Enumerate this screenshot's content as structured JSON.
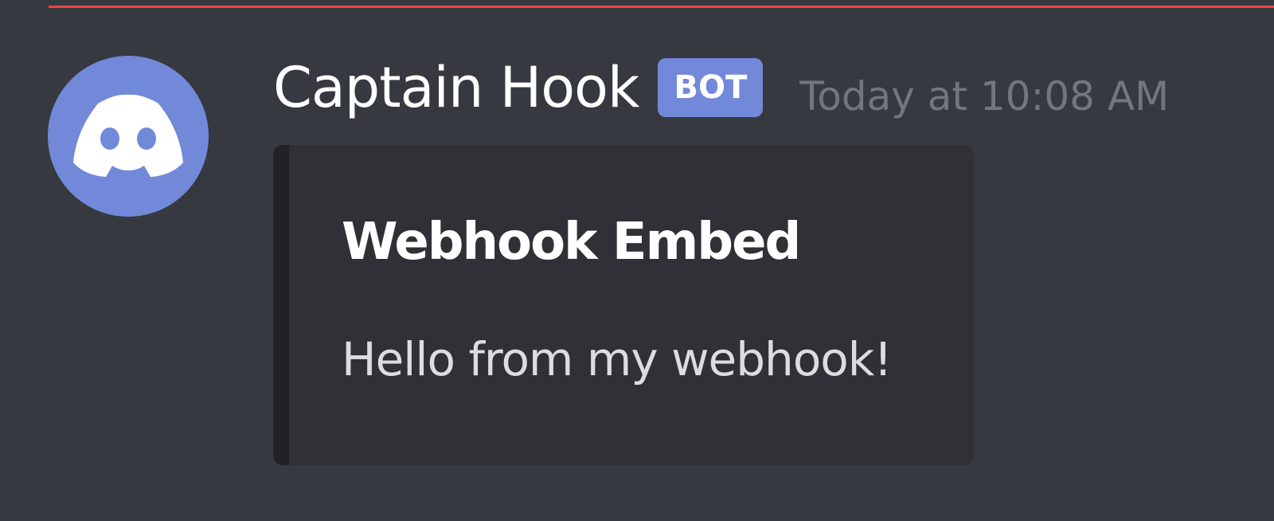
{
  "message": {
    "author": {
      "username": "Captain Hook",
      "bot_badge": "BOT",
      "avatar_icon": "discord-logo-icon"
    },
    "timestamp": "Today at 10:08 AM",
    "embed": {
      "title": "Webhook Embed",
      "description": "Hello from my webhook!"
    }
  },
  "colors": {
    "background": "#36393f",
    "divider": "#ed4245",
    "avatar": "#7289da",
    "bot_badge": "#7289da",
    "embed_background": "#2f3136",
    "embed_border": "#202225",
    "timestamp": "#72767d",
    "text": "#ffffff"
  }
}
